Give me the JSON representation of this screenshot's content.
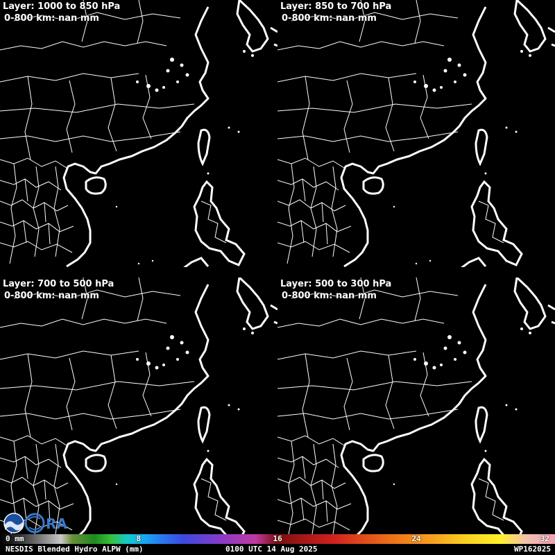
{
  "panels": [
    {
      "layer": "Layer: 1000 to 850 hPa",
      "stat": "0-800 km: nan mm"
    },
    {
      "layer": "Layer: 850 to 700 hPa",
      "stat": "0-800 km: nan mm"
    },
    {
      "layer": "Layer: 700 to 500 hPa",
      "stat": "0-800 km: nan mm"
    },
    {
      "layer": "Layer: 500 to 300 hPa",
      "stat": "0-800 km: nan mm"
    }
  ],
  "colorbar": {
    "ticks": [
      "0 mm",
      "8",
      "16",
      "24",
      "32"
    ],
    "tick_values": [
      0,
      8,
      16,
      24,
      32
    ],
    "range": [
      0,
      32
    ]
  },
  "footer": {
    "product": "NESDIS Blended Hydro ALPW (mm)",
    "time": "0100 UTC 14 Aug 2025",
    "storm": "WP162025"
  },
  "logos": {
    "noaa": "NOAA",
    "cira": "CIRA"
  },
  "colors": {
    "background": "#000000",
    "coastline": "#ffffff"
  }
}
